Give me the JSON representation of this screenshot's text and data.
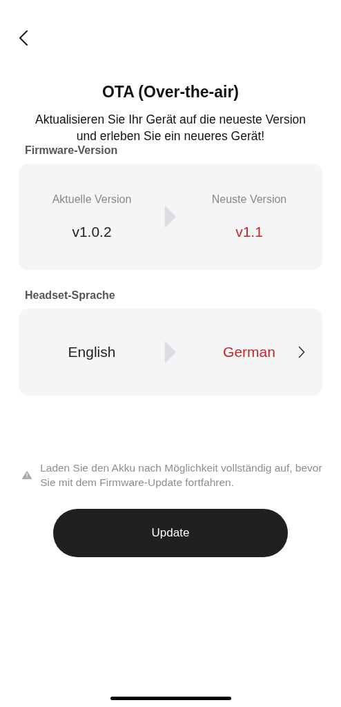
{
  "title": "OTA (Over-the-air)",
  "subtitle": "Aktualisieren Sie Ihr Gerät auf die neueste Version und erleben Sie ein neueres Gerät!",
  "firmware": {
    "label": "Firmware-Version",
    "current_caption": "Aktuelle Version",
    "current": "v1.0.2",
    "latest_caption": "Neuste Version",
    "latest": "v1.1"
  },
  "language": {
    "label": "Headset-Sprache",
    "current": "English",
    "target": "German"
  },
  "warning": "Laden Sie den Akku nach Möglichkeit vollständig auf, bevor Sie mit dem Firmware-Update fortfahren.",
  "button": "Update"
}
